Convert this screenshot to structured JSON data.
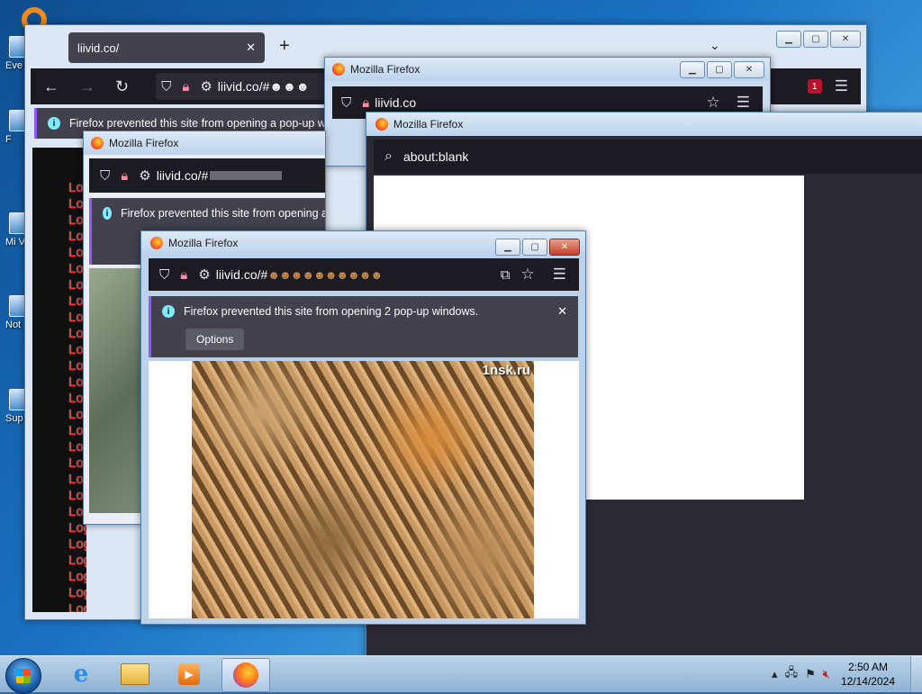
{
  "desktop_icons": [
    {
      "label": "Eve"
    },
    {
      "label": "F"
    },
    {
      "label": "Mi Visu"
    },
    {
      "label": "Not"
    },
    {
      "label": "Sup"
    }
  ],
  "main_window": {
    "tab_title": "liivid.co/",
    "url": "liivid.co/#☻☻☻",
    "notice": "Firefox prevented this site from opening a pop-up win",
    "badge_count": "1",
    "log_lines": [
      "Lo",
      "Lo",
      "Lo",
      "Lo",
      "Lo",
      "Lo",
      "Lo",
      "Lo",
      "Lo",
      "Lo",
      "Lo",
      "Lo",
      "Lo",
      "Lo",
      "Lo",
      "Lo",
      "Lo",
      "Lo",
      "Lo",
      "Lo",
      "Lo",
      "Logging yo",
      "Logging yo",
      "Logging yo",
      "Logging yo",
      "Logging yo",
      "Logging yo"
    ]
  },
  "popup_top": {
    "title": "Mozilla Firefox",
    "url": "liivid.co"
  },
  "popup_blank": {
    "title": "Mozilla Firefox",
    "url": "about:blank"
  },
  "popup_left": {
    "title": "Mozilla Firefox",
    "url": "liivid.co/#",
    "notice": "Firefox prevented this site from opening a"
  },
  "popup_front": {
    "title": "Mozilla Firefox",
    "url": "liivid.co/#",
    "emoji": "☻☻☻☻☻☻☻☻☻☻",
    "notice": "Firefox prevented this site from opening 2 pop-up windows.",
    "options_label": "Options",
    "watermark": "1nsk.ru"
  },
  "taskbar": {
    "time": "2:50 AM",
    "date": "12/14/2024"
  },
  "colors": {
    "log_text": "#ff2a2a",
    "accent": "#9059ff",
    "info": "#80ebff"
  }
}
